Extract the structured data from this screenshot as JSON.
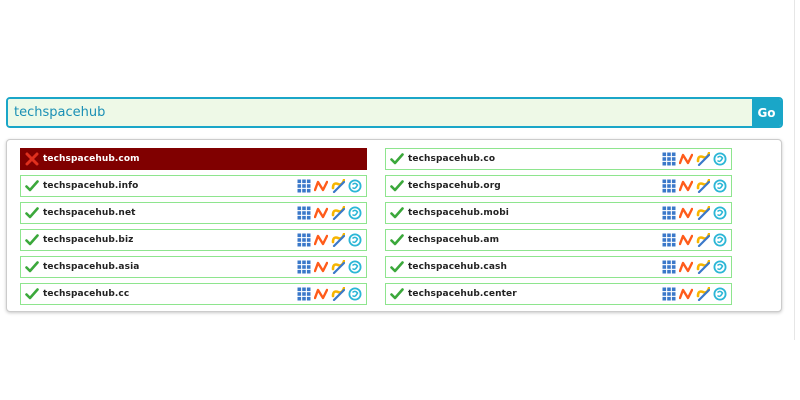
{
  "search": {
    "value": "techspacehub",
    "button_label": "Go"
  },
  "colors": {
    "accent": "#1aa6c8",
    "input_bg": "#eef9e7",
    "available_border": "#8ee58e",
    "taken_bg": "#800000",
    "check_green": "#3ba83b",
    "cross_red": "#e0301e"
  },
  "icons": {
    "available": "check-icon",
    "taken": "cross-icon",
    "registrars": [
      "grid-icon",
      "namecheap-icon",
      "godaddy-icon",
      "dynadot-icon"
    ]
  },
  "results": {
    "left": [
      {
        "domain": "techspacehub.com",
        "status": "taken"
      },
      {
        "domain": "techspacehub.info",
        "status": "available"
      },
      {
        "domain": "techspacehub.net",
        "status": "available"
      },
      {
        "domain": "techspacehub.biz",
        "status": "available"
      },
      {
        "domain": "techspacehub.asia",
        "status": "available"
      },
      {
        "domain": "techspacehub.cc",
        "status": "available"
      }
    ],
    "right": [
      {
        "domain": "techspacehub.co",
        "status": "available"
      },
      {
        "domain": "techspacehub.org",
        "status": "available"
      },
      {
        "domain": "techspacehub.mobi",
        "status": "available"
      },
      {
        "domain": "techspacehub.am",
        "status": "available"
      },
      {
        "domain": "techspacehub.cash",
        "status": "available"
      },
      {
        "domain": "techspacehub.center",
        "status": "available"
      }
    ]
  }
}
